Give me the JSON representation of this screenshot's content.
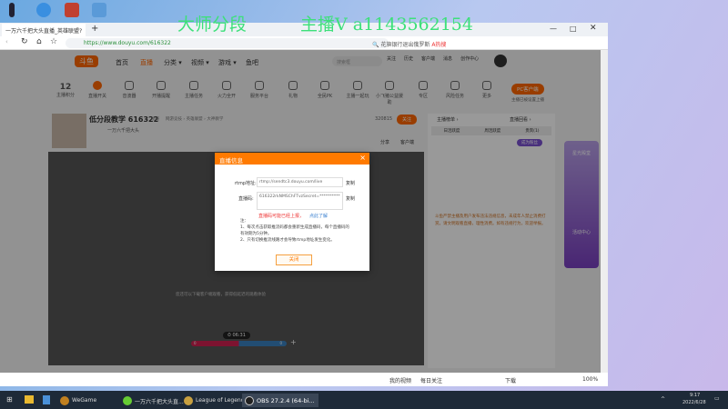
{
  "watermark": {
    "left": "大师分段",
    "right": "主播V a1143562154"
  },
  "browser": {
    "tab_title": "一万六千把大头直播_英雄联盟?",
    "new_tab": "+",
    "url": "https://www.douyu.com/616322",
    "search_placeholder": "花旗银行退出俄罗斯",
    "search_hot": "A热搜"
  },
  "site": {
    "logo": "斗鱼",
    "nav": [
      "首页",
      "直播",
      "分类 ▾",
      "视频 ▾",
      "游戏 ▾",
      "鱼吧"
    ],
    "search_placeholder": "搜索框",
    "header_icons": [
      "关注",
      "历史",
      "客户端",
      "消息",
      "创作中心"
    ],
    "tools": [
      {
        "label": "主播积分",
        "value": "12"
      },
      {
        "label": "直播开关"
      },
      {
        "label": "音波器"
      },
      {
        "label": "开播提醒"
      },
      {
        "label": "主播任务"
      },
      {
        "label": "火力全开"
      },
      {
        "label": "服务平台"
      },
      {
        "label": "礼物"
      },
      {
        "label": "全民PK"
      },
      {
        "label": "主播一起玩"
      },
      {
        "label": "小飞猪公益援助"
      },
      {
        "label": "专区"
      },
      {
        "label": "风险任务"
      },
      {
        "label": "更多"
      }
    ],
    "pc_button": "PC客户端",
    "pc_sub": "主播已被设置上播",
    "streamer": {
      "title": "低分段教学 616322",
      "report": "举报",
      "category": "网游竞技 › 英雄联盟 › 大神教学",
      "name": "一万六千把大头",
      "follow_count": "320815",
      "follow": "关注",
      "share": "分享",
      "download": "客户端"
    },
    "rank_tabs": [
      "日活跃度",
      "周活跃度",
      "贵宾(1)"
    ],
    "rank_title": "主播榜单 ›",
    "live_replay": "直播回看 ›",
    "fans": "成为粉丝",
    "video_msg": "您还可以下载客户端观看，获得低延迟的观看体验",
    "timer": "06:31",
    "score_left": "0",
    "score_right": "0",
    "chat_notice": "斗鱼严禁主播及用户发布违法违规信息，未成年人禁止消费打赏。请文明观看直播，理性消费。如有违规行为，欢迎举报。",
    "ad": {
      "title": "星光殿堂",
      "btn": "活动中心"
    }
  },
  "dialog": {
    "title": "直播信息",
    "close_x": "×",
    "rtmp_label": "rtmp地址:",
    "rtmp_value": "rtmp://sendtc3.douyu.com/live",
    "code_label": "直播码:",
    "code_value": "616322rkNMSChFTvzSecret=**********",
    "copy": "复制",
    "warning": "直播码可能已经上报，",
    "learn_more": "点此了解",
    "note_title": "注：",
    "note1": "1、每次点击获取推流码都会重新生成直播码，每个直播码的有效期为5分钟。",
    "note2": "2、只有切换推流线路才会导致rtmp地址发生变化。",
    "close_button": "关闭"
  },
  "status_bar": {
    "items": [
      "我的视频",
      "每日关注",
      "下载",
      "100%"
    ]
  },
  "taskbar": {
    "apps": [
      "WeGame",
      "一万六千把大头直...",
      "League of Legends",
      "OBS 27.2.4 (64-bi..."
    ],
    "time": "9:17",
    "date": "2022/6/28"
  },
  "colors": {
    "accent": "#ff7a00",
    "watermark": "#3de07a"
  }
}
